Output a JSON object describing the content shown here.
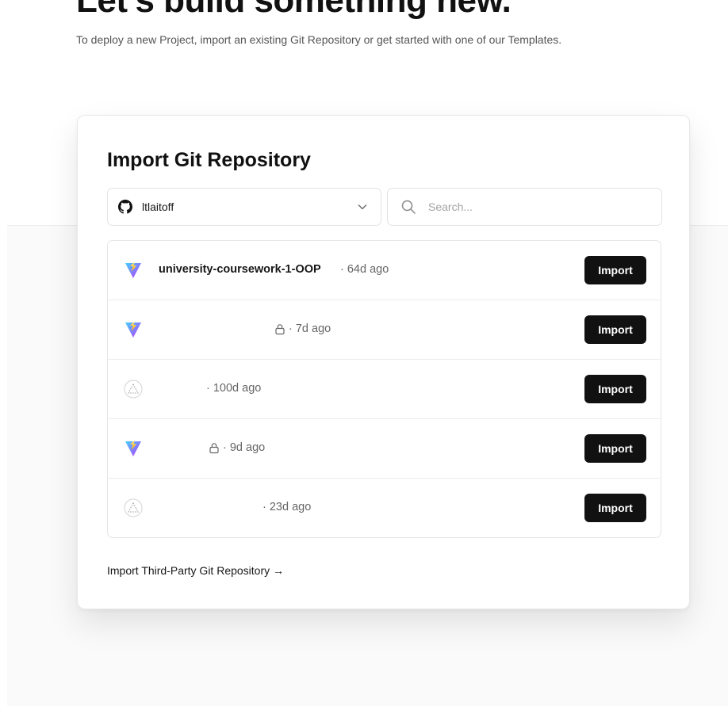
{
  "hero": {
    "title": "Let's build something new.",
    "subtitle": "To deploy a new Project, import an existing Git Repository or get started with one of our Templates."
  },
  "import_card": {
    "title": "Import Git Repository",
    "account": {
      "name": "ltlaitoff",
      "icon": "github-icon"
    },
    "search": {
      "placeholder": "Search...",
      "value": ""
    },
    "repos": [
      {
        "name": "university-coursework-1-OOP",
        "meta": "· 64d ago",
        "icon": "vite-icon",
        "private": false,
        "button": "Import"
      },
      {
        "name": "",
        "meta": "· 7d ago",
        "icon": "vite-icon",
        "private": true,
        "button": "Import"
      },
      {
        "name": "",
        "meta": "· 100d ago",
        "icon": "vercel-triangle-icon",
        "private": false,
        "button": "Import"
      },
      {
        "name": "",
        "meta": "· 9d ago",
        "icon": "vite-icon",
        "private": true,
        "button": "Import"
      },
      {
        "name": "",
        "meta": "· 23d ago",
        "icon": "vercel-triangle-icon",
        "private": false,
        "button": "Import"
      }
    ],
    "third_party_link": "Import Third-Party Git Repository →"
  }
}
